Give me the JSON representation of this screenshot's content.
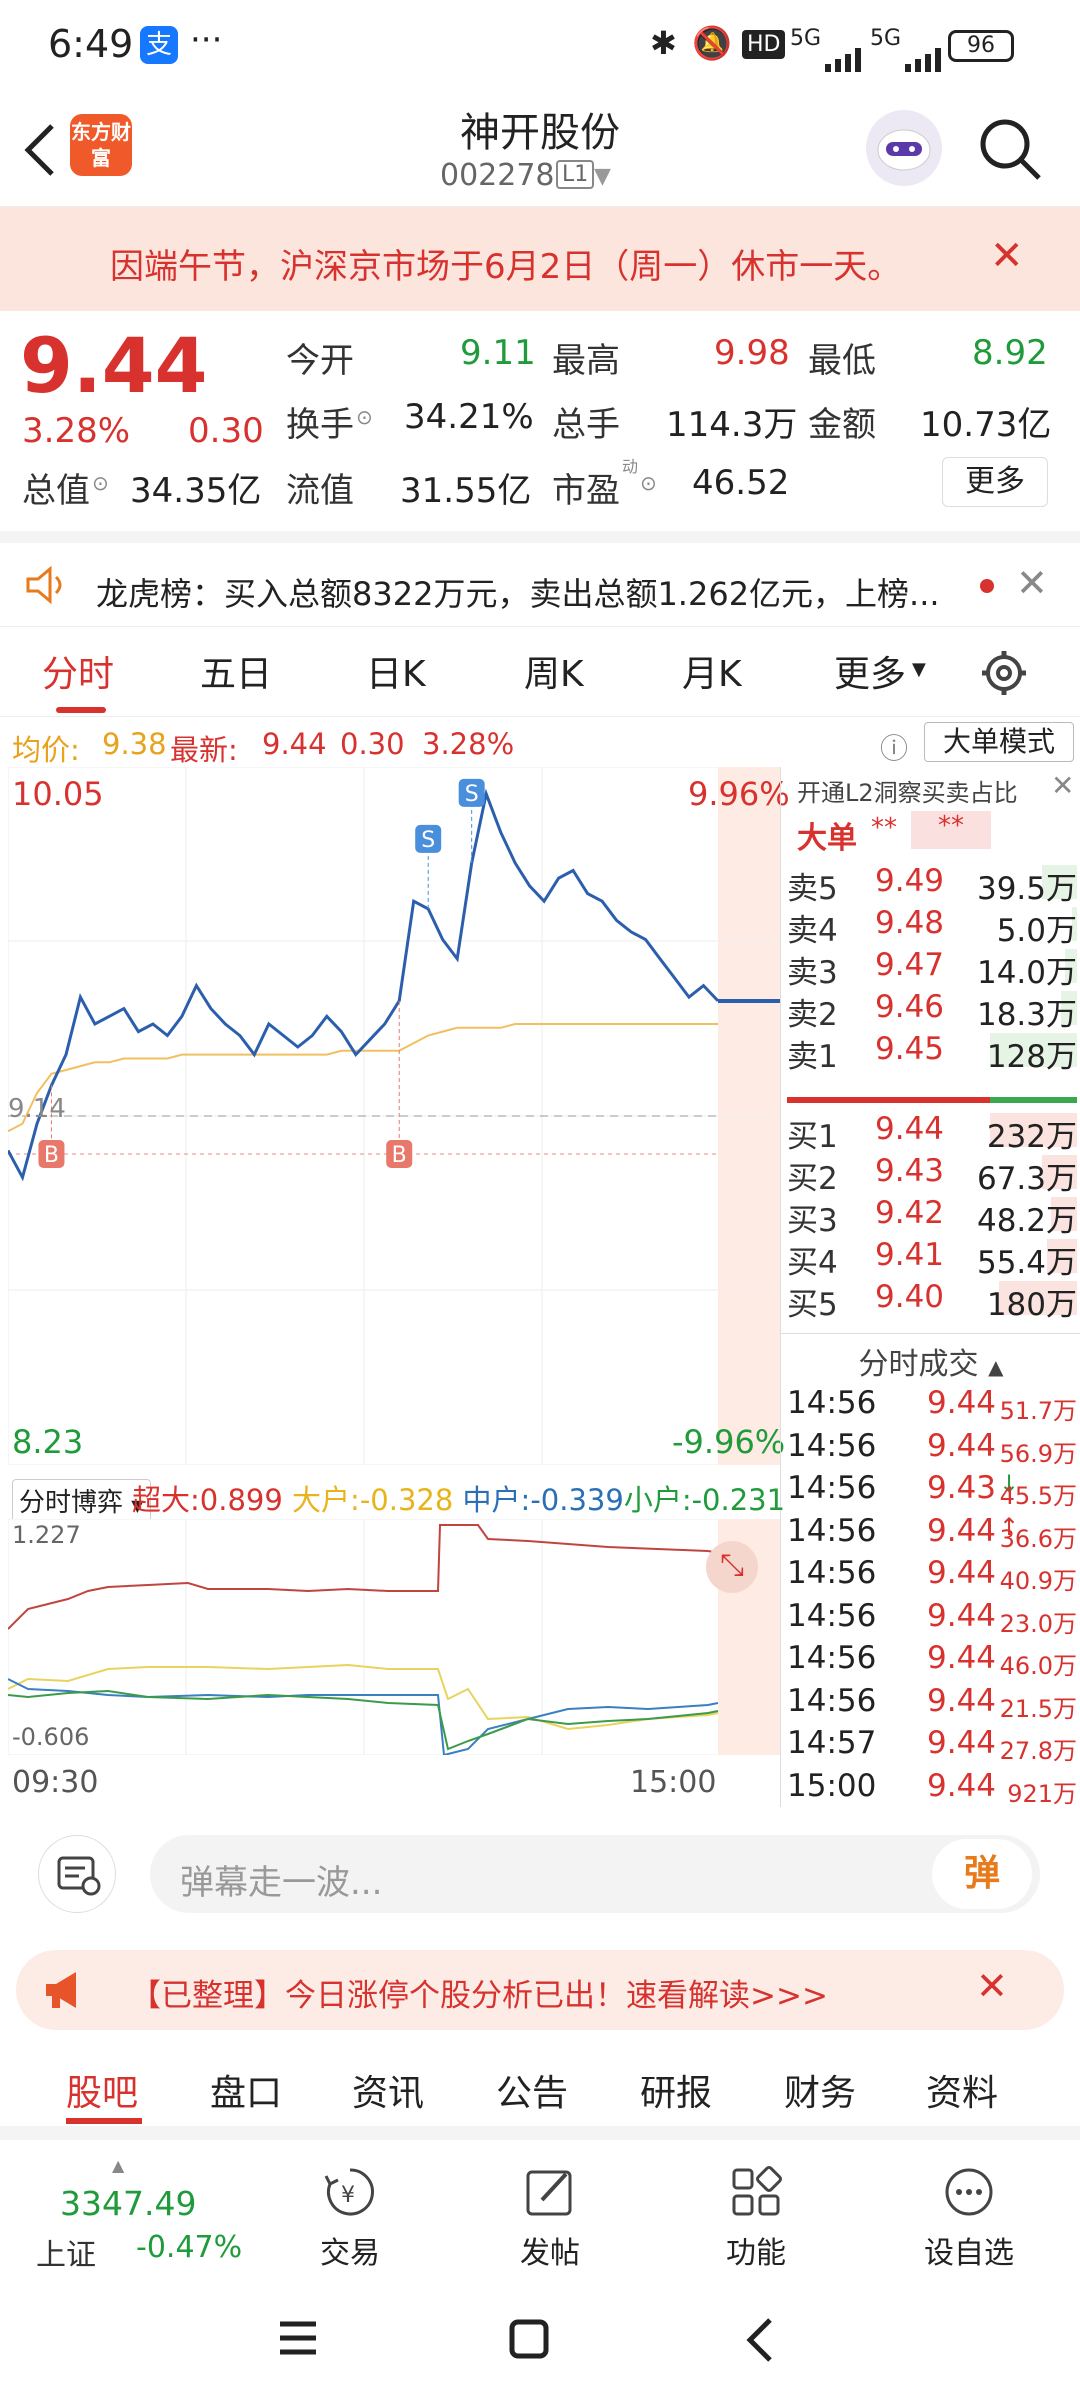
{
  "status_bar": {
    "time": "6:49",
    "alipay_badge": "支",
    "more": "···",
    "hd": "HD",
    "net1": "5G",
    "net2": "5G",
    "battery": "96"
  },
  "header": {
    "logo": "东方财富",
    "title": "神开股份",
    "code": "002278",
    "level": "L1"
  },
  "notice": {
    "text": "因端午节，沪深京市场于6月2日（周一）休市一天。"
  },
  "quote": {
    "price": "9.44",
    "change_pct": "3.28%",
    "change": "0.30",
    "open_label": "今开",
    "open": "9.11",
    "high_label": "最高",
    "high": "9.98",
    "low_label": "最低",
    "low": "8.92",
    "turnover_label": "换手",
    "turnover": "34.21%",
    "volume_label": "总手",
    "volume": "114.3万",
    "amount_label": "金额",
    "amount": "10.73亿",
    "mktcap_label": "总值",
    "mktcap": "34.35亿",
    "float_label": "流值",
    "float": "31.55亿",
    "pe_label": "市盈",
    "pe_sup": "动",
    "pe": "46.52",
    "more_button": "更多"
  },
  "dragon_tiger": {
    "text": "龙虎榜：买入总额8322万元，卖出总额1.262亿元，上榜..."
  },
  "k_tabs": [
    "分时",
    "五日",
    "日K",
    "周K",
    "月K",
    "更多"
  ],
  "avg_line": {
    "avg_label": "均价:",
    "avg": "9.38",
    "latest_label": "最新:",
    "latest": "9.44",
    "chg": "0.30",
    "pct": "3.28%",
    "big_order_mode": "大单模式"
  },
  "chart": {
    "y_max": "10.05",
    "y_min": "8.23",
    "pct_max": "9.96%",
    "pct_min": "-9.96%",
    "ref_label": "9.14",
    "markers": {
      "buy": "B",
      "sell": "S"
    }
  },
  "chart_data": {
    "type": "line",
    "title": "",
    "ylim": [
      8.23,
      10.05
    ],
    "reference": 9.14,
    "series": [
      {
        "name": "",
        "values": [
          9.05,
          8.98,
          9.12,
          9.22,
          9.3,
          9.45,
          9.38,
          9.4,
          9.42,
          9.36,
          9.38,
          9.35,
          9.4,
          9.48,
          9.42,
          9.38,
          9.35,
          9.3,
          9.38,
          9.35,
          9.32,
          9.35,
          9.4,
          9.36,
          9.3,
          9.34,
          9.38,
          9.44,
          9.7,
          9.68,
          9.6,
          9.55,
          9.8,
          9.98,
          9.88,
          9.8,
          9.74,
          9.7,
          9.76,
          9.78,
          9.72,
          9.7,
          9.65,
          9.62,
          9.6,
          9.55,
          9.5,
          9.45,
          9.48,
          9.44
        ]
      },
      {
        "name": "均价",
        "values": [
          9.1,
          9.12,
          9.2,
          9.25,
          9.26,
          9.27,
          9.28,
          9.28,
          9.29,
          9.29,
          9.29,
          9.29,
          9.3,
          9.3,
          9.3,
          9.3,
          9.3,
          9.3,
          9.3,
          9.3,
          9.3,
          9.3,
          9.3,
          9.31,
          9.31,
          9.31,
          9.31,
          9.31,
          9.33,
          9.35,
          9.36,
          9.37,
          9.37,
          9.37,
          9.37,
          9.38,
          9.38,
          9.38,
          9.38,
          9.38,
          9.38,
          9.38,
          9.38,
          9.38,
          9.38,
          9.38,
          9.38,
          9.38,
          9.38,
          9.38
        ]
      }
    ]
  },
  "flow": {
    "label": "分时博弈",
    "super_label": "超大:",
    "super": "0.899",
    "large_label": "大户:",
    "large": "-0.328",
    "mid_label": "中户:",
    "mid": "-0.339",
    "small_label": "小户:",
    "small": "-0.231",
    "max": "1.227",
    "min": "-0.606"
  },
  "time_axis": {
    "start": "09:30",
    "end": "15:00"
  },
  "orderbook": {
    "l2_promo": "开通L2洞察买卖占比",
    "big_label": "大单",
    "big_mask1": "**",
    "big_mask2": "**",
    "asks": [
      {
        "label": "卖5",
        "price": "9.49",
        "vol": "39.5万"
      },
      {
        "label": "卖4",
        "price": "9.48",
        "vol": "5.0万"
      },
      {
        "label": "卖3",
        "price": "9.47",
        "vol": "14.0万"
      },
      {
        "label": "卖2",
        "price": "9.46",
        "vol": "18.3万"
      },
      {
        "label": "卖1",
        "price": "9.45",
        "vol": "128万"
      }
    ],
    "bids": [
      {
        "label": "买1",
        "price": "9.44",
        "vol": "232万"
      },
      {
        "label": "买2",
        "price": "9.43",
        "vol": "67.3万"
      },
      {
        "label": "买3",
        "price": "9.42",
        "vol": "48.2万"
      },
      {
        "label": "买4",
        "price": "9.41",
        "vol": "55.4万"
      },
      {
        "label": "买5",
        "price": "9.40",
        "vol": "180万"
      }
    ],
    "trades_title": "分时成交",
    "trades": [
      {
        "time": "14:56",
        "price": "9.44",
        "vol": "51.7万"
      },
      {
        "time": "14:56",
        "price": "9.44",
        "vol": "56.9万"
      },
      {
        "time": "14:56",
        "price": "9.43",
        "vol": "45.5万",
        "arrow": "↓"
      },
      {
        "time": "14:56",
        "price": "9.44",
        "vol": "36.6万",
        "arrow": "↑"
      },
      {
        "time": "14:56",
        "price": "9.44",
        "vol": "40.9万"
      },
      {
        "time": "14:56",
        "price": "9.44",
        "vol": "23.0万"
      },
      {
        "time": "14:56",
        "price": "9.44",
        "vol": "46.0万"
      },
      {
        "time": "14:56",
        "price": "9.44",
        "vol": "21.5万"
      },
      {
        "time": "14:57",
        "price": "9.44",
        "vol": "27.8万"
      },
      {
        "time": "15:00",
        "price": "9.44",
        "vol": "921万"
      }
    ]
  },
  "danmu": {
    "placeholder": "弹幕走一波...",
    "button": "弹"
  },
  "ad": {
    "text": "【已整理】今日涨停个股分析已出！速看解读>>>"
  },
  "bottom_tabs": [
    "股吧",
    "盘口",
    "资讯",
    "公告",
    "研报",
    "财务",
    "资料"
  ],
  "bottom_bar": {
    "index_value": "3347.49",
    "index_name": "上证",
    "index_change": "-0.47%",
    "trade": "交易",
    "post": "发帖",
    "func": "功能",
    "watch": "设自选"
  },
  "colors": {
    "up": "#d8322f",
    "down": "#1f9b3b",
    "accent": "#e87a1c",
    "price_line": "#2b5fad",
    "avg_line": "#f0c060"
  }
}
